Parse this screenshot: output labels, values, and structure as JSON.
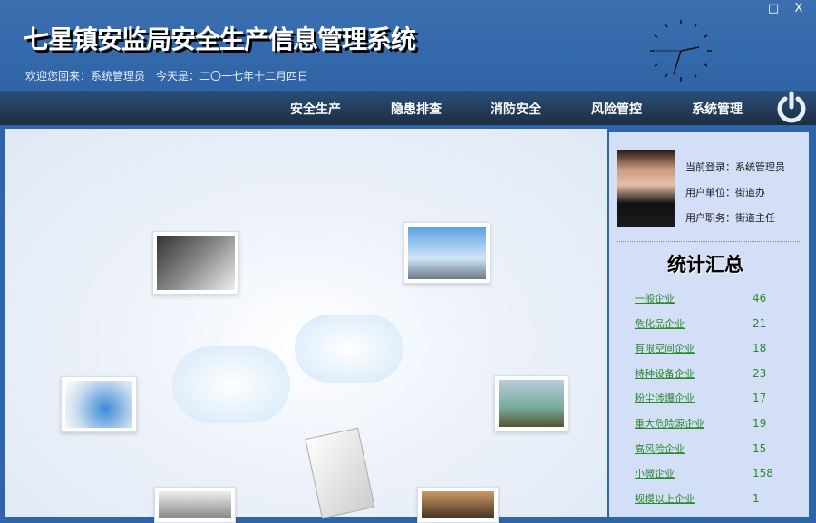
{
  "header": {
    "title": "七星镇安监局安全生产信息管理系统",
    "welcome": "欢迎您回来：系统管理员",
    "today": "今天是：二〇一七年十二月四日",
    "maximize": "□",
    "close": "X"
  },
  "nav": [
    {
      "label": "安全生产"
    },
    {
      "label": "隐患排查"
    },
    {
      "label": "消防安全"
    },
    {
      "label": "风险管控"
    },
    {
      "label": "系统管理"
    }
  ],
  "user": {
    "login": "当前登录：系统管理员",
    "unit": "用户单位：街道办",
    "position": "用户职务：街道主任"
  },
  "stats": {
    "title": "统计汇总",
    "items": [
      {
        "label": "一般企业",
        "value": "46"
      },
      {
        "label": "危化品企业",
        "value": "21"
      },
      {
        "label": "有限空间企业",
        "value": "18"
      },
      {
        "label": "特种设备企业",
        "value": "23"
      },
      {
        "label": "粉尘涉爆企业",
        "value": "17"
      },
      {
        "label": "重大危险源企业",
        "value": "19"
      },
      {
        "label": "高风险企业",
        "value": "15"
      },
      {
        "label": "小微企业",
        "value": "158"
      },
      {
        "label": "规模以上企业",
        "value": "1"
      }
    ]
  },
  "colors": {
    "header": "#2f64a6",
    "nav": "#1d2d40",
    "sidebar": "#d3def7",
    "stat_text": "#2a8a2a"
  }
}
